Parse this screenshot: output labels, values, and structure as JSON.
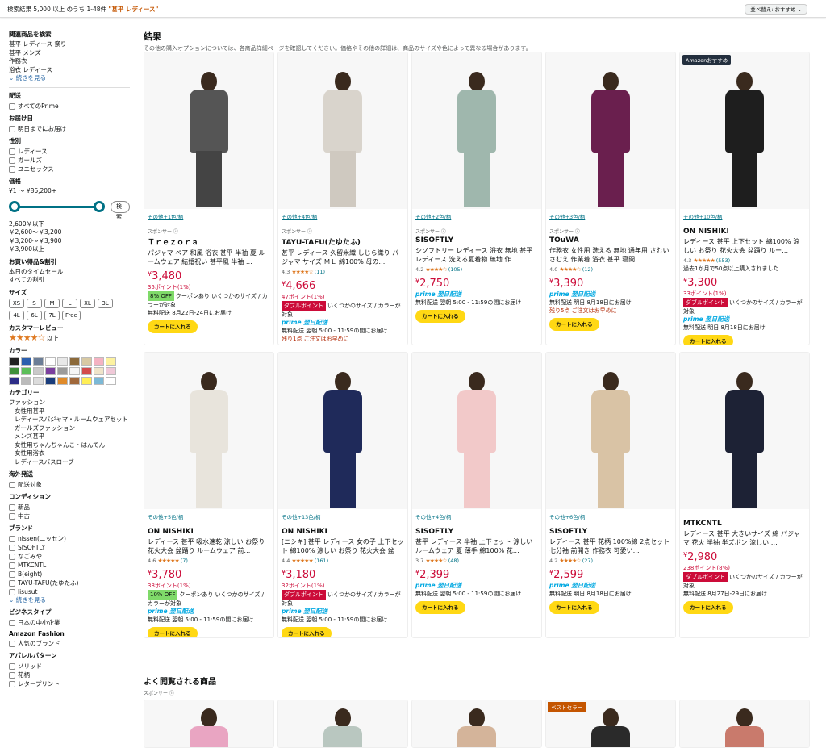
{
  "header": {
    "results_prefix": "検索結果 5,000 以上 のうち 1-48件",
    "query": "\"甚平 レディース\"",
    "sort_label": "並べ替え: おすすめ ⌄"
  },
  "sidebar": {
    "related_title": "関連商品を検索",
    "related": [
      "甚平 レディース 祭り",
      "甚平 メンズ",
      "作務衣",
      "浴衣 レディース"
    ],
    "related_more": "⌄ 続きを見る",
    "delivery_title": "配送",
    "delivery_opt": "すべてのPrime",
    "date_title": "お届け日",
    "date_opt": "明日までにお届け",
    "gender_title": "性別",
    "gender": [
      "レディース",
      "ガールズ",
      "ユニセックス"
    ],
    "price_title": "価格",
    "price_range": "¥1 〜 ¥86,200+",
    "price_go": "検索",
    "price_ranges": [
      "2,600￥以下",
      "￥2,600～￥3,200",
      "￥3,200～￥3,900",
      "￥3,900以上"
    ],
    "deals_title": "お買い得品&割引",
    "deals": [
      "本日のタイムセール",
      "すべての割引"
    ],
    "size_title": "サイズ",
    "sizes": [
      "XS",
      "S",
      "M",
      "L",
      "XL",
      "3L",
      "4L",
      "6L",
      "7L",
      "Free"
    ],
    "review_title": "カスタマーレビュー",
    "review_stars": "★★★★☆",
    "review_up": "以上",
    "color_title": "カラー",
    "colors": [
      "#222222",
      "#2b5fae",
      "#6b7d96",
      "#ffffff",
      "#e8e8e8",
      "#8c6a3b",
      "#d8c9a3",
      "#f4b3c2",
      "#fdf2a0",
      "#3f8f3a",
      "#5dbf5a",
      "#c9c9c9",
      "#7b3f9e",
      "#9b9b9b",
      "#f6f6f6",
      "#d34c4c",
      "#efe4c9",
      "#f0c9d8",
      "#2d2d88",
      "#bbbbbb",
      "#dcdcdc",
      "#1a3d7c",
      "#e08b2a",
      "#a0683b",
      "#ffee55",
      "#7cb9d6",
      "#ffffff"
    ],
    "category_title": "カテゴリー",
    "categories": [
      "ファッション",
      "女性用甚平",
      "レディースパジャマ・ルームウェアセット",
      "ガールズファッション",
      "メンズ甚平",
      "女性用ちゃんちゃんこ・はんてん",
      "女性用浴衣",
      "レディースバスローブ"
    ],
    "intl_title": "海外発送",
    "intl_opt": "配送対象",
    "cond_title": "コンディション",
    "conditions": [
      "新品",
      "中古"
    ],
    "brand_title": "ブランド",
    "brands": [
      "nissen(ニッセン)",
      "SISOFTLY",
      "なごみや",
      "MTKCNTL",
      "B(eight)",
      "TAYU-TAFU(たゆたふ)",
      "lisusut"
    ],
    "brand_more": "⌄ 続きを見る",
    "biz_title": "ビジネスタイプ",
    "biz_opt": "日本の中小企業",
    "fashion_title": "Amazon Fashion",
    "fashion_opt": "人気のブランド",
    "pattern_title": "アパレルパターン",
    "patterns": [
      "ソリッド",
      "花柄",
      "レタープリント"
    ]
  },
  "main": {
    "heading": "結果",
    "subtitle": "その他の購入オプションについては、各商品詳細ページを確認してください。価格やその他の詳細は、商品のサイズや色によって異なる場合があります。",
    "cart_label": "カートに入れる",
    "sponsored_label": "スポンサー ⓘ",
    "products": [
      {
        "swatch": "その他+1色/柄",
        "sponsored": true,
        "brand": "Ｔｒｅｚｏｒａ",
        "title": "パジャマ ペア 和風 浴衣 甚平 半袖 夏 ルームウェア 結婚祝い 甚平風 半袖 …",
        "stars": "",
        "rating": "",
        "count": "",
        "price": "3,480",
        "points": "35ポイント(1%)",
        "tag": "8% OFF",
        "tag_type": "green",
        "tag_note": "クーポンあり いくつかのサイズ / カラーが対象",
        "prime": "",
        "delivery": "無料配送 8月22日-24日にお届け",
        "warn": "",
        "img_color": "#555555",
        "legs_color": "#444444"
      },
      {
        "swatch": "その他+4色/柄",
        "sponsored": true,
        "brand": "TAYU-TAFU(たゆたふ)",
        "title": "甚平 レディース 久留米織 しじら織り パジャマ サイズ ＭＬ 綿100% 母の…",
        "stars": "★★★★☆",
        "rating": "4.3",
        "count": "(11)",
        "price": "4,666",
        "points": "47ポイント(1%)",
        "tag": "ダブルポイント",
        "tag_type": "red",
        "tag_note": "いくつかのサイズ / カラーが対象",
        "prime": "prime 翌日配送",
        "delivery": "無料配送 翌朝 5:00 - 11:59の間にお届け",
        "warn": "残り1点 ご注文はお早めに",
        "img_color": "#d9d4cc",
        "legs_color": "#cfc9c0"
      },
      {
        "swatch": "その他+2色/柄",
        "sponsored": true,
        "brand": "SISOFTLY",
        "title": "シソフトリー レディース 浴衣 無地 甚平 レディース 洗える夏着物 無地 作…",
        "stars": "★★★★☆",
        "rating": "4.2",
        "count": "(105)",
        "price": "2,750",
        "points": "",
        "tag": "",
        "tag_type": "",
        "tag_note": "",
        "prime": "prime 翌日配送",
        "delivery": "無料配送 翌朝 5:00 - 11:59の間にお届け",
        "warn": "",
        "img_color": "#9fb7ad",
        "legs_color": "#9fb7ad"
      },
      {
        "swatch": "その他+3色/柄",
        "sponsored": true,
        "brand": "TOuWA",
        "title": "作務衣 女性用 洗える 無地 通年用 さむい さむえ 作業着 浴衣 甚平 寝間…",
        "stars": "★★★★☆",
        "rating": "4.0",
        "count": "(12)",
        "price": "3,390",
        "points": "",
        "tag": "",
        "tag_type": "",
        "tag_note": "",
        "prime": "prime 翌日配送",
        "delivery": "無料配送 明日 8月18日にお届け",
        "warn": "残り5点 ご注文はお早めに",
        "img_color": "#6a1f4e",
        "legs_color": "#6a1f4e"
      },
      {
        "swatch": "その他+10色/柄",
        "sponsored": false,
        "reco": "Amazonおすすめ",
        "brand": "ON NISHIKI",
        "title": "レディース 甚平 上下セット 綿100% 涼しい お祭り 花火大会 盆踊り ルー…",
        "stars": "★★★★★",
        "rating": "4.3",
        "count": "(553)",
        "bought": "過去1か月で50点以上購入されました",
        "price": "3,300",
        "points": "33ポイント(1%)",
        "tag": "ダブルポイント",
        "tag_type": "red",
        "tag_note": "いくつかのサイズ / カラーが対象",
        "prime": "prime 翌日配送",
        "delivery": "無料配送 明日 8月18日にお届け",
        "warn": "",
        "img_color": "#1e1e1e",
        "legs_color": "#1e1e1e"
      },
      {
        "swatch": "その他+5色/柄",
        "sponsored": false,
        "brand": "ON NISHIKI",
        "title": "レディース 甚平 吸水速乾 涼しい お祭り 花火大会 盆踊り ルームウェア 前…",
        "stars": "★★★★★",
        "rating": "4.6",
        "count": "(7)",
        "price": "3,780",
        "points": "38ポイント(1%)",
        "tag": "10% OFF",
        "tag_type": "green",
        "tag_note": "クーポンあり いくつかのサイズ / カラーが対象",
        "prime": "prime 翌日配送",
        "delivery": "無料配送 翌朝 5:00 - 11:59の間にお届け",
        "warn": "",
        "img_color": "#e8e4dc",
        "legs_color": "#e8e4dc"
      },
      {
        "swatch": "その他+13色/柄",
        "sponsored": false,
        "brand": "ON NISHIKI",
        "title": "[ニシキ] 甚平 レディース 女の子 上下セット 綿100% 涼しい お祭り 花火大会 盆踊…",
        "stars": "★★★★★",
        "rating": "4.4",
        "count": "(161)",
        "price": "3,180",
        "points": "32ポイント(1%)",
        "tag": "ダブルポイント",
        "tag_type": "red",
        "tag_note": "いくつかのサイズ / カラーが対象",
        "prime": "prime 翌日配送",
        "delivery": "無料配送 翌朝 5:00 - 11:59の間にお届け",
        "warn": "",
        "img_color": "#1f2a5a",
        "legs_color": "#1f2a5a"
      },
      {
        "swatch": "その他+4色/柄",
        "sponsored": false,
        "brand": "SISOFTLY",
        "title": "甚平 レディース 半袖 上下セット 涼しい ルームウェア 夏 薄手 綿100% 花…",
        "stars": "★★★★☆",
        "rating": "3.7",
        "count": "(48)",
        "price": "2,399",
        "points": "",
        "tag": "",
        "tag_type": "",
        "tag_note": "",
        "prime": "prime 翌日配送",
        "delivery": "無料配送 翌朝 5:00 - 11:59の間にお届け",
        "warn": "",
        "img_color": "#f2c9c9",
        "legs_color": "#f2c9c9"
      },
      {
        "swatch": "その他+6色/柄",
        "sponsored": false,
        "brand": "SISOFTLY",
        "title": "レディース 甚平 花柄 100%綿 2点セット 七分袖 前開き 作務衣 可愛い…",
        "stars": "★★★★☆",
        "rating": "4.2",
        "count": "(27)",
        "price": "2,599",
        "points": "",
        "tag": "",
        "tag_type": "",
        "tag_note": "",
        "prime": "prime 翌日配送",
        "delivery": "無料配送 明日 8月18日にお届け",
        "warn": "",
        "img_color": "#d9c3a5",
        "legs_color": "#d9c3a5"
      },
      {
        "swatch": "",
        "sponsored": false,
        "brand": "MTKCNTL",
        "title": "レディース 甚平 大きいサイズ 綿 パジャマ 花火 半袖 半ズボン 涼しい …",
        "stars": "",
        "rating": "",
        "count": "",
        "price": "2,980",
        "points": "238ポイント(8%)",
        "tag": "ダブルポイント",
        "tag_type": "red",
        "tag_note": "いくつかのサイズ / カラーが対象",
        "prime": "",
        "delivery": "無料配送 8月27日-29日にお届け",
        "warn": "",
        "img_color": "#1d2235",
        "legs_color": "#1d2235"
      }
    ],
    "also_heading": "よく閲覧される商品",
    "also_sponsored": "スポンサー ⓘ",
    "also_items": [
      {
        "color": "#e9a5c2",
        "badge": ""
      },
      {
        "color": "#b9c7c0",
        "badge": ""
      },
      {
        "color": "#d4b49a",
        "badge": ""
      },
      {
        "color": "#2a2a2a",
        "badge": "ベストセラー"
      },
      {
        "color": "#c97a6c",
        "badge": ""
      }
    ]
  }
}
